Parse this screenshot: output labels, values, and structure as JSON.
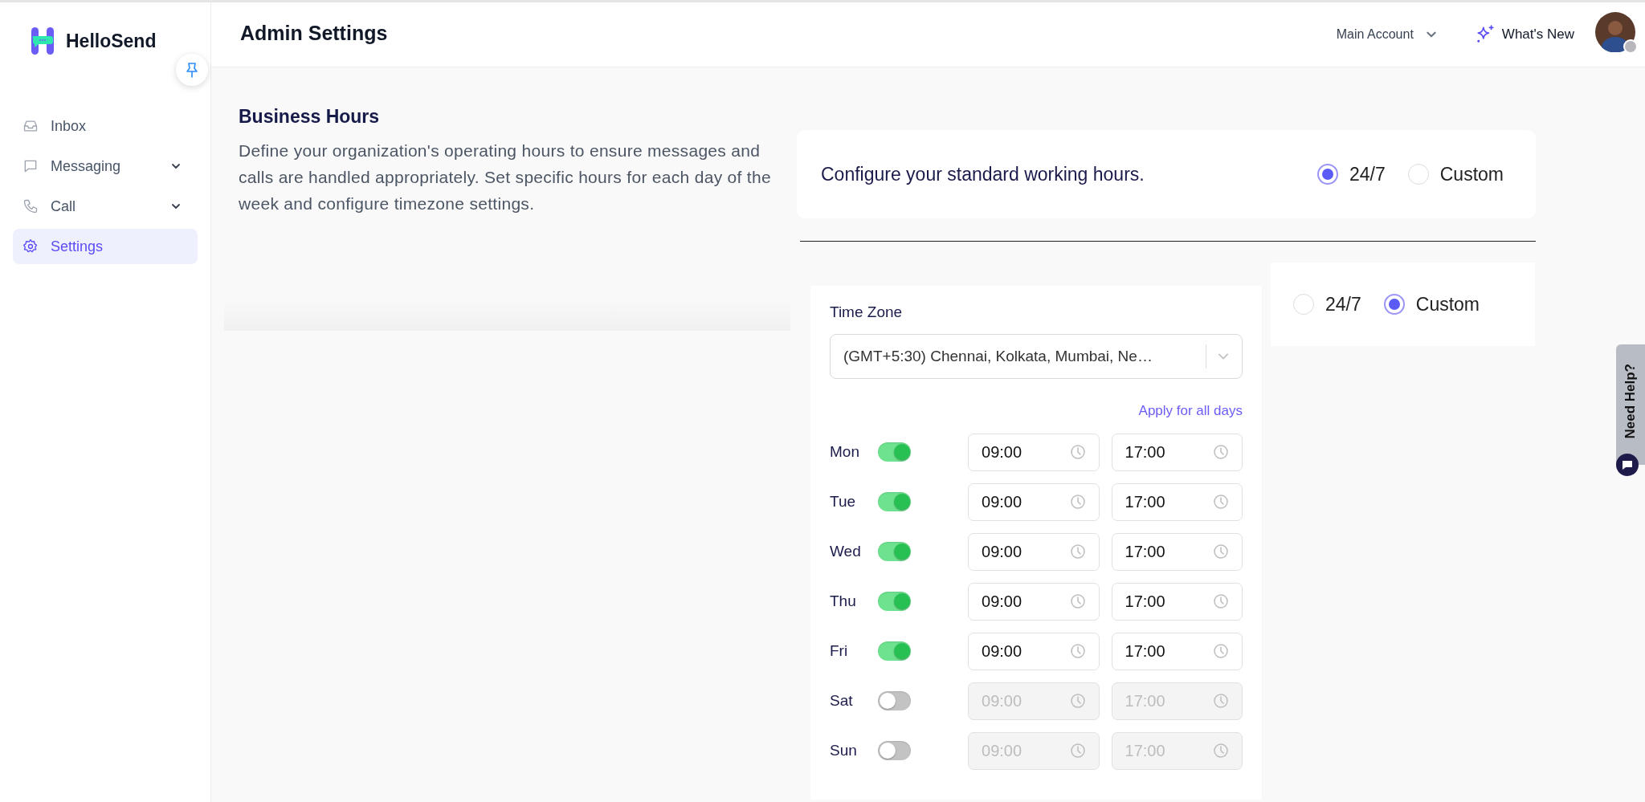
{
  "app": {
    "name": "HelloSend"
  },
  "sidebar": {
    "items": [
      {
        "label": "Inbox",
        "kind": "inbox",
        "has_submenu": false,
        "selected": false
      },
      {
        "label": "Messaging",
        "kind": "message",
        "has_submenu": true,
        "selected": false
      },
      {
        "label": "Call",
        "kind": "phone",
        "has_submenu": true,
        "selected": false
      },
      {
        "label": "Settings",
        "kind": "gear",
        "has_submenu": false,
        "selected": true
      }
    ]
  },
  "header": {
    "title": "Admin Settings",
    "account": "Main Account",
    "whats_new": "What's New"
  },
  "section": {
    "title": "Business Hours",
    "description": "Define your organization's operating hours to ensure messages and calls are handled appropriately. Set specific hours for each day of the week and configure timezone settings."
  },
  "standard_hours": {
    "text": "Configure your standard working hours.",
    "options": [
      {
        "label": "24/7",
        "selected": true
      },
      {
        "label": "Custom",
        "selected": false
      }
    ]
  },
  "custom_hours": {
    "options": [
      {
        "label": "24/7",
        "selected": false
      },
      {
        "label": "Custom",
        "selected": true
      }
    ]
  },
  "timezone": {
    "label": "Time Zone",
    "value": "(GMT+5:30) Chennai, Kolkata, Mumbai, Ne…"
  },
  "apply_all": "Apply for all days",
  "days": [
    {
      "day": "Mon",
      "on": true,
      "start": "09:00",
      "end": "17:00"
    },
    {
      "day": "Tue",
      "on": true,
      "start": "09:00",
      "end": "17:00"
    },
    {
      "day": "Wed",
      "on": true,
      "start": "09:00",
      "end": "17:00"
    },
    {
      "day": "Thu",
      "on": true,
      "start": "09:00",
      "end": "17:00"
    },
    {
      "day": "Fri",
      "on": true,
      "start": "09:00",
      "end": "17:00"
    },
    {
      "day": "Sat",
      "on": false,
      "start": "09:00",
      "end": "17:00"
    },
    {
      "day": "Sun",
      "on": false,
      "start": "09:00",
      "end": "17:00"
    }
  ],
  "help": {
    "label": "Need Help?"
  }
}
